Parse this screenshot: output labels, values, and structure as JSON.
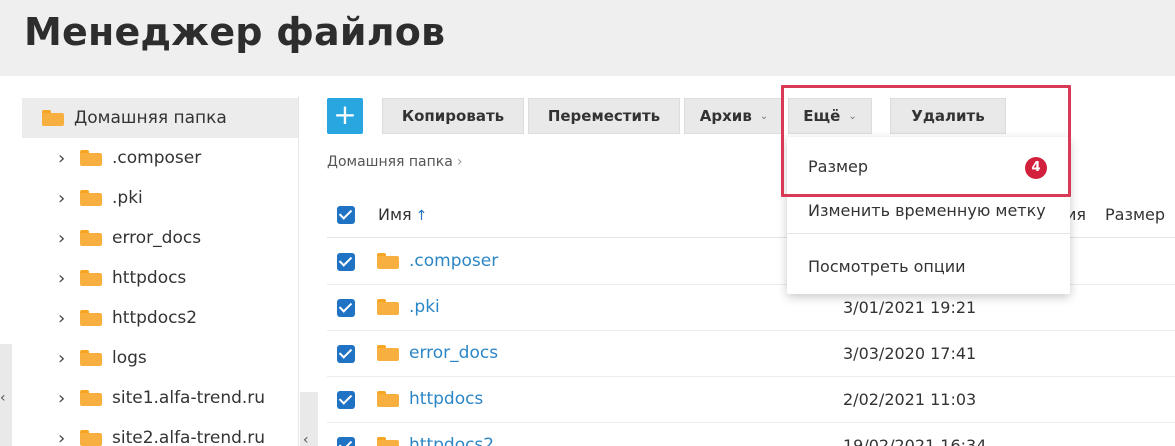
{
  "header": {
    "title": "Менеджер файлов"
  },
  "sidebar": {
    "home_label": "Домашняя папка",
    "items": [
      {
        "label": ".composer"
      },
      {
        "label": ".pki"
      },
      {
        "label": "error_docs"
      },
      {
        "label": "httpdocs"
      },
      {
        "label": "httpdocs2"
      },
      {
        "label": "logs"
      },
      {
        "label": "site1.alfa-trend.ru"
      },
      {
        "label": "site2.alfa-trend.ru"
      }
    ]
  },
  "toolbar": {
    "add_label": "+",
    "copy_label": "Копировать",
    "move_label": "Переместить",
    "archive_label": "Архив",
    "more_label": "Ещё",
    "delete_label": "Удалить"
  },
  "breadcrumb": {
    "home": "Домашняя папка"
  },
  "table": {
    "col_name": "Имя",
    "col_partial": "ия",
    "col_size": "Размер",
    "rows": [
      {
        "name": ".composer",
        "date": ""
      },
      {
        "name": ".pki",
        "date": "3/01/2021 19:21"
      },
      {
        "name": "error_docs",
        "date": "3/03/2020 17:41"
      },
      {
        "name": "httpdocs",
        "date": "2/02/2021 11:03"
      },
      {
        "name": "httpdocs2",
        "date": "19/02/2021 16:34"
      }
    ]
  },
  "menu": {
    "items": [
      {
        "label": "Размер"
      },
      {
        "label": "Изменить временную метку"
      },
      {
        "label": "Посмотреть опции"
      }
    ],
    "badge": "4"
  },
  "colors": {
    "accent": "#28a6e0",
    "link": "#2a86c6",
    "checkbox": "#1f72c4",
    "highlight": "#d83a55",
    "folder": "#f7b040"
  }
}
